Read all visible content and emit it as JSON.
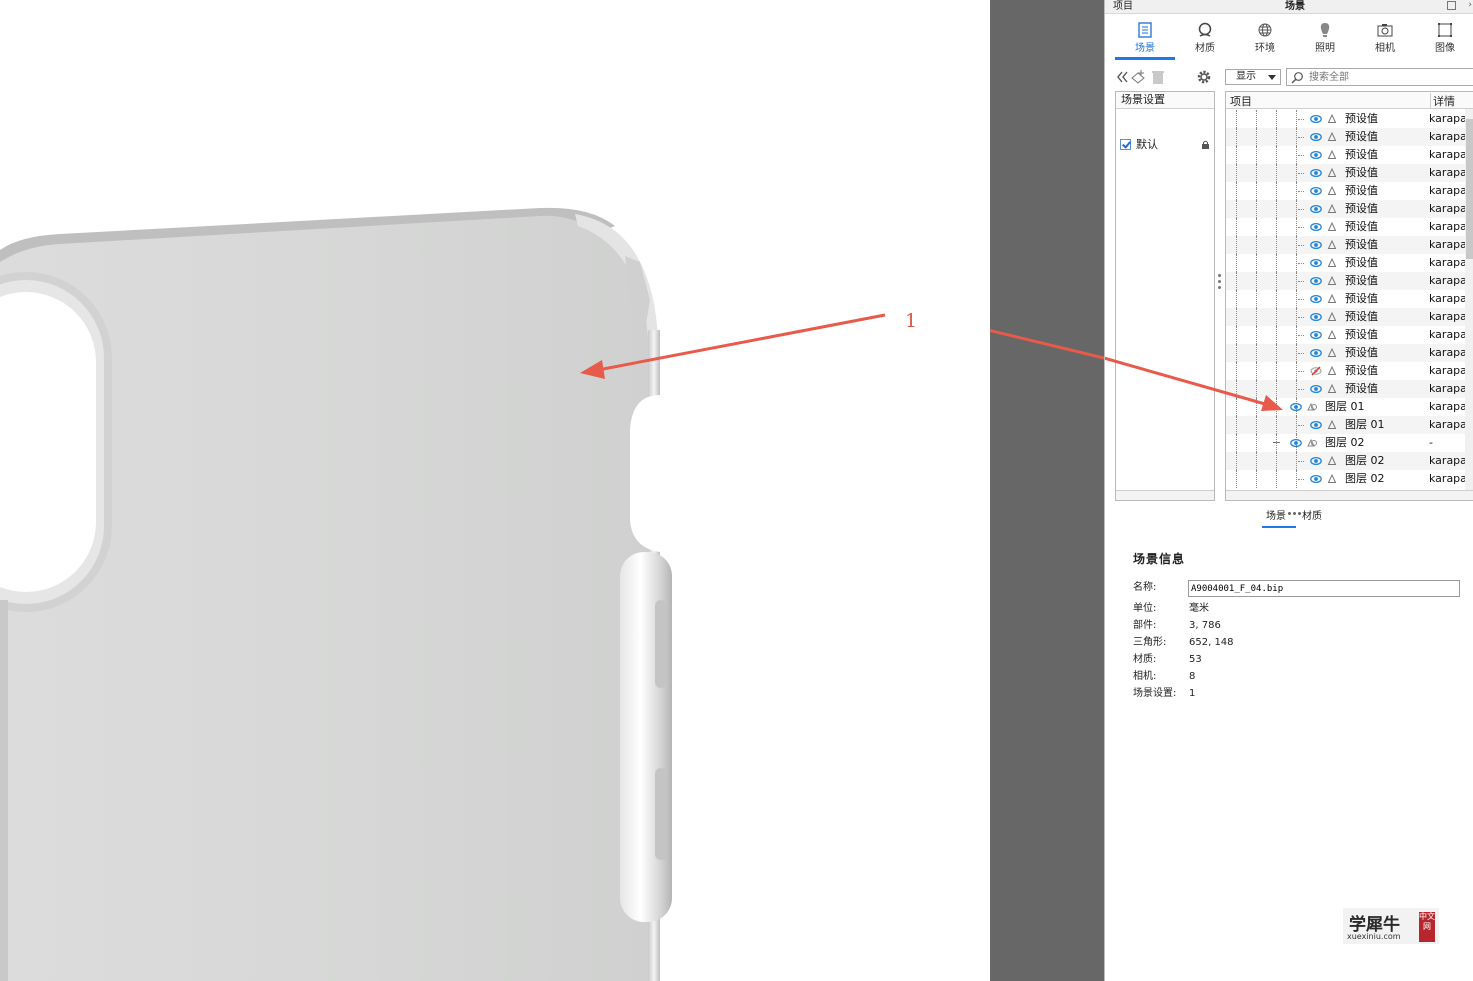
{
  "annotation": {
    "label": "1",
    "color": "#e85a4a"
  },
  "panel": {
    "top_left": "项目",
    "title": "场景",
    "tabs": [
      {
        "label": "场景",
        "icon": "scene-list-icon",
        "active": true
      },
      {
        "label": "材质",
        "icon": "material-icon",
        "active": false
      },
      {
        "label": "环境",
        "icon": "globe-icon",
        "active": false
      },
      {
        "label": "照明",
        "icon": "lightbulb-icon",
        "active": false
      },
      {
        "label": "相机",
        "icon": "camera-icon",
        "active": false
      },
      {
        "label": "图像",
        "icon": "image-frame-icon",
        "active": false
      }
    ],
    "toolbar": {
      "display_select": "显示",
      "search_placeholder": "搜索全部"
    },
    "scene_settings": {
      "header": "场景设置",
      "item": "默认",
      "checked": true
    },
    "tree": {
      "col_item": "项目",
      "col_detail": "详情",
      "rows": [
        {
          "name": "预设值",
          "detail": "karapa",
          "level": 2,
          "hidden": false
        },
        {
          "name": "预设值",
          "detail": "karapa",
          "level": 2,
          "hidden": false
        },
        {
          "name": "预设值",
          "detail": "karapa",
          "level": 2,
          "hidden": false
        },
        {
          "name": "预设值",
          "detail": "karapa",
          "level": 2,
          "hidden": false
        },
        {
          "name": "预设值",
          "detail": "karapa",
          "level": 2,
          "hidden": false
        },
        {
          "name": "预设值",
          "detail": "karapa",
          "level": 2,
          "hidden": false
        },
        {
          "name": "预设值",
          "detail": "karapa",
          "level": 2,
          "hidden": false
        },
        {
          "name": "预设值",
          "detail": "karapa",
          "level": 2,
          "hidden": false
        },
        {
          "name": "预设值",
          "detail": "karapa",
          "level": 2,
          "hidden": false
        },
        {
          "name": "预设值",
          "detail": "karapa",
          "level": 2,
          "hidden": false
        },
        {
          "name": "预设值",
          "detail": "karapa",
          "level": 2,
          "hidden": false
        },
        {
          "name": "预设值",
          "detail": "karapa",
          "level": 2,
          "hidden": false
        },
        {
          "name": "预设值",
          "detail": "karapa",
          "level": 2,
          "hidden": false
        },
        {
          "name": "预设值",
          "detail": "karapa",
          "level": 2,
          "hidden": false
        },
        {
          "name": "预设值",
          "detail": "karapa",
          "level": 2,
          "hidden": true
        },
        {
          "name": "预设值",
          "detail": "karapa",
          "level": 2,
          "hidden": false
        },
        {
          "name": "图层 01",
          "detail": "karapa",
          "level": 1,
          "hidden": false,
          "group": true
        },
        {
          "name": "图层 01",
          "detail": "karapa",
          "level": 2,
          "hidden": false
        },
        {
          "name": "图层 02",
          "detail": "-",
          "level": 1,
          "hidden": false,
          "group": true,
          "expanded": true
        },
        {
          "name": "图层 02",
          "detail": "karapa",
          "level": 2,
          "hidden": false
        },
        {
          "name": "图层 02",
          "detail": "karapa",
          "level": 2,
          "hidden": false
        }
      ]
    },
    "subtabs": [
      {
        "label": "场景",
        "active": true
      },
      {
        "label": "材质",
        "active": false
      }
    ],
    "scene_info": {
      "title": "场景信息",
      "name_label": "名称:",
      "name_value": "A9004001_F_04.bip",
      "unit_label": "单位:",
      "unit_value": "毫米",
      "parts_label": "部件:",
      "parts_value": "3, 786",
      "tris_label": "三角形:",
      "tris_value": "652, 148",
      "materials_label": "材质:",
      "materials_value": "53",
      "cameras_label": "相机:",
      "cameras_value": "8",
      "settings_label": "场景设置:",
      "settings_value": "1"
    },
    "watermark": {
      "main": "学犀牛",
      "sub": "xuexiniu.com",
      "seal": "中文网"
    }
  },
  "colors": {
    "accent": "#1a7be8",
    "eye": "#1f86d9",
    "gutter": "#676767"
  }
}
